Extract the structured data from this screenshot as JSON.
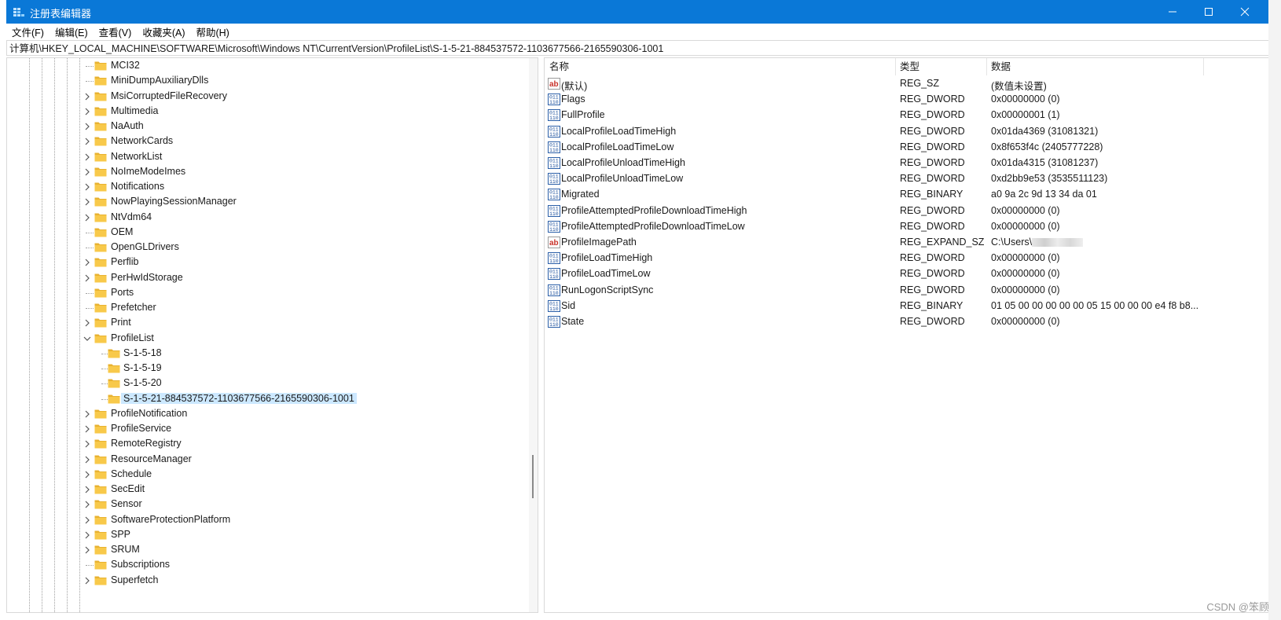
{
  "window": {
    "title": "注册表编辑器"
  },
  "controls": {
    "minimize": "—",
    "maximize": "☐",
    "close": "✕"
  },
  "menu": [
    {
      "label": "文件(F)"
    },
    {
      "label": "编辑(E)"
    },
    {
      "label": "查看(V)"
    },
    {
      "label": "收藏夹(A)"
    },
    {
      "label": "帮助(H)"
    }
  ],
  "address": "计算机\\HKEY_LOCAL_MACHINE\\SOFTWARE\\Microsoft\\Windows NT\\CurrentVersion\\ProfileList\\S-1-5-21-884537572-1103677566-2165590306-1001",
  "tree": {
    "items": [
      {
        "label": "MCI32",
        "expander": "none"
      },
      {
        "label": "MiniDumpAuxiliaryDlls",
        "expander": "none"
      },
      {
        "label": "MsiCorruptedFileRecovery",
        "expander": "collapsed"
      },
      {
        "label": "Multimedia",
        "expander": "collapsed"
      },
      {
        "label": "NaAuth",
        "expander": "collapsed"
      },
      {
        "label": "NetworkCards",
        "expander": "collapsed"
      },
      {
        "label": "NetworkList",
        "expander": "collapsed"
      },
      {
        "label": "NoImeModeImes",
        "expander": "collapsed"
      },
      {
        "label": "Notifications",
        "expander": "collapsed"
      },
      {
        "label": "NowPlayingSessionManager",
        "expander": "collapsed"
      },
      {
        "label": "NtVdm64",
        "expander": "collapsed"
      },
      {
        "label": "OEM",
        "expander": "none"
      },
      {
        "label": "OpenGLDrivers",
        "expander": "none"
      },
      {
        "label": "Perflib",
        "expander": "collapsed"
      },
      {
        "label": "PerHwIdStorage",
        "expander": "collapsed"
      },
      {
        "label": "Ports",
        "expander": "none"
      },
      {
        "label": "Prefetcher",
        "expander": "none"
      },
      {
        "label": "Print",
        "expander": "collapsed"
      },
      {
        "label": "ProfileList",
        "expander": "expanded"
      },
      {
        "label": "S-1-5-18",
        "expander": "none",
        "child": true
      },
      {
        "label": "S-1-5-19",
        "expander": "none",
        "child": true
      },
      {
        "label": "S-1-5-20",
        "expander": "none",
        "child": true
      },
      {
        "label": "S-1-5-21-884537572-1103677566-2165590306-1001",
        "expander": "none",
        "child": true,
        "selected": true
      },
      {
        "label": "ProfileNotification",
        "expander": "collapsed"
      },
      {
        "label": "ProfileService",
        "expander": "collapsed"
      },
      {
        "label": "RemoteRegistry",
        "expander": "collapsed"
      },
      {
        "label": "ResourceManager",
        "expander": "collapsed"
      },
      {
        "label": "Schedule",
        "expander": "collapsed"
      },
      {
        "label": "SecEdit",
        "expander": "collapsed"
      },
      {
        "label": "Sensor",
        "expander": "collapsed"
      },
      {
        "label": "SoftwareProtectionPlatform",
        "expander": "collapsed"
      },
      {
        "label": "SPP",
        "expander": "collapsed"
      },
      {
        "label": "SRUM",
        "expander": "collapsed"
      },
      {
        "label": "Subscriptions",
        "expander": "none"
      },
      {
        "label": "Superfetch",
        "expander": "collapsed"
      }
    ]
  },
  "list": {
    "headers": {
      "name": "名称",
      "type": "类型",
      "data": "数据"
    },
    "rows": [
      {
        "icon": "string",
        "name": "(默认)",
        "type": "REG_SZ",
        "data": "(数值未设置)"
      },
      {
        "icon": "binary",
        "name": "Flags",
        "type": "REG_DWORD",
        "data": "0x00000000 (0)"
      },
      {
        "icon": "binary",
        "name": "FullProfile",
        "type": "REG_DWORD",
        "data": "0x00000001 (1)"
      },
      {
        "icon": "binary",
        "name": "LocalProfileLoadTimeHigh",
        "type": "REG_DWORD",
        "data": "0x01da4369 (31081321)"
      },
      {
        "icon": "binary",
        "name": "LocalProfileLoadTimeLow",
        "type": "REG_DWORD",
        "data": "0x8f653f4c (2405777228)"
      },
      {
        "icon": "binary",
        "name": "LocalProfileUnloadTimeHigh",
        "type": "REG_DWORD",
        "data": "0x01da4315 (31081237)"
      },
      {
        "icon": "binary",
        "name": "LocalProfileUnloadTimeLow",
        "type": "REG_DWORD",
        "data": "0xd2bb9e53 (3535511123)"
      },
      {
        "icon": "binary",
        "name": "Migrated",
        "type": "REG_BINARY",
        "data": "a0 9a 2c 9d 13 34 da 01"
      },
      {
        "icon": "binary",
        "name": "ProfileAttemptedProfileDownloadTimeHigh",
        "type": "REG_DWORD",
        "data": "0x00000000 (0)"
      },
      {
        "icon": "binary",
        "name": "ProfileAttemptedProfileDownloadTimeLow",
        "type": "REG_DWORD",
        "data": "0x00000000 (0)"
      },
      {
        "icon": "string",
        "name": "ProfileImagePath",
        "type": "REG_EXPAND_SZ",
        "data": "C:\\Users\\",
        "redacted": true
      },
      {
        "icon": "binary",
        "name": "ProfileLoadTimeHigh",
        "type": "REG_DWORD",
        "data": "0x00000000 (0)"
      },
      {
        "icon": "binary",
        "name": "ProfileLoadTimeLow",
        "type": "REG_DWORD",
        "data": "0x00000000 (0)"
      },
      {
        "icon": "binary",
        "name": "RunLogonScriptSync",
        "type": "REG_DWORD",
        "data": "0x00000000 (0)"
      },
      {
        "icon": "binary",
        "name": "Sid",
        "type": "REG_BINARY",
        "data": "01 05 00 00 00 00 00 05 15 00 00 00 e4 f8 b8..."
      },
      {
        "icon": "binary",
        "name": "State",
        "type": "REG_DWORD",
        "data": "0x00000000 (0)"
      }
    ]
  },
  "watermark": "CSDN @笨顾明",
  "colors": {
    "titlebar": "#0a78d7",
    "selection": "#cce8ff",
    "folder": "#f8c94a"
  }
}
